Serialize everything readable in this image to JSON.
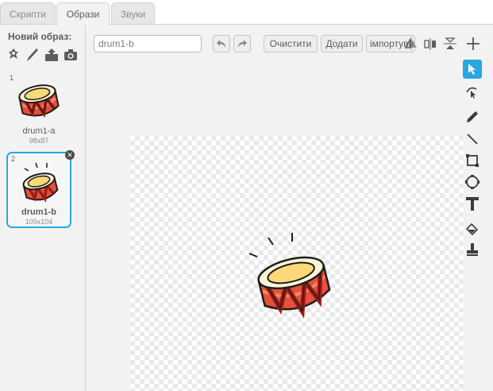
{
  "tabs": [
    {
      "label": "Скрипти",
      "active": false
    },
    {
      "label": "Образи",
      "active": true
    },
    {
      "label": "Звуки",
      "active": false
    }
  ],
  "left_panel": {
    "new_costume_label": "Новий образ:",
    "new_icons": [
      "sprite-library-icon",
      "paint-brush-icon",
      "upload-icon",
      "camera-icon"
    ],
    "costumes": [
      {
        "number": "1",
        "name": "drum1-a",
        "size": "98x87",
        "selected": false
      },
      {
        "number": "2",
        "name": "drum1-b",
        "size": "109x104",
        "selected": true
      }
    ]
  },
  "editor": {
    "costume_name_value": "drum1-b",
    "undo_icon": "undo-icon",
    "redo_icon": "redo-icon",
    "clear_label": "Очистити",
    "add_label": "Додати",
    "import_label": "імпортувати",
    "header_icons": [
      "flip-horizontal-icon",
      "flip-horizontal-alt-icon",
      "flip-vertical-icon",
      "set-center-icon"
    ],
    "tools": [
      "select-arrow-icon",
      "reshape-icon",
      "pencil-icon",
      "line-icon",
      "rectangle-icon",
      "ellipse-icon",
      "text-icon",
      "fill-bucket-icon",
      "stamp-icon"
    ],
    "selected_tool": "select-arrow-icon"
  },
  "colors": {
    "accent": "#2aa7e0",
    "panel_bg": "#f2f2f2",
    "drum_red": "#e8503a",
    "drum_cream": "#fbe5a4",
    "drum_dark": "#9b1e1a"
  }
}
